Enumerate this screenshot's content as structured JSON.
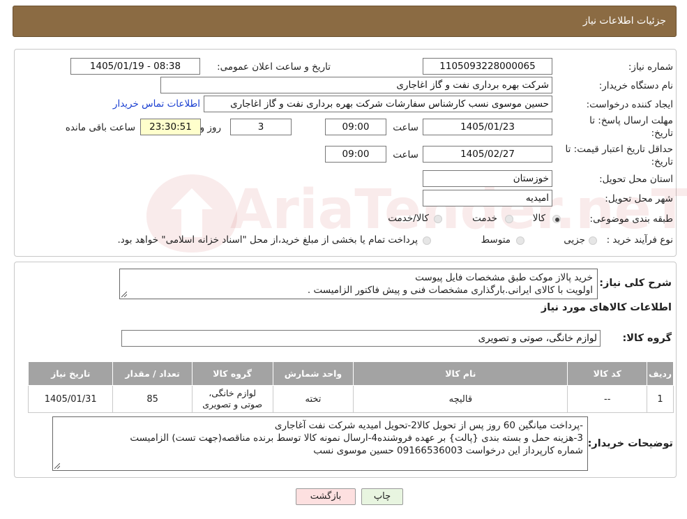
{
  "header": {
    "title": "جزئیات اطلاعات نیاز"
  },
  "watermark": "AriaTender.neT",
  "form": {
    "need_number_label": "شماره نیاز:",
    "need_number": "1105093228000065",
    "announce_label": "تاریخ و ساعت اعلان عمومی:",
    "announce_value": "1405/01/19 - 08:38",
    "buyer_org_label": "نام دستگاه خریدار:",
    "buyer_org": "شرکت بهره برداری نفت و گاز اغاجاری",
    "creator_label": "ایجاد کننده درخواست:",
    "creator": "حسین موسوی نسب کارشناس سفارشات شرکت بهره برداری نفت و گاز اغاجاری",
    "contact_link": "اطلاعات تماس خریدار",
    "deadline_label_1": "مهلت ارسال پاسخ: تا",
    "deadline_label_2": "تاریخ:",
    "deadline_date": "1405/01/23",
    "time_label": "ساعت",
    "deadline_time": "09:00",
    "days_value": "3",
    "days_label": "روز و",
    "remaining_time": "23:30:51",
    "remaining_label": "ساعت باقی مانده",
    "validity_label_1": "حداقل تاریخ اعتبار قیمت: تا",
    "validity_label_2": "تاریخ:",
    "validity_date": "1405/02/27",
    "validity_time": "09:00",
    "province_label": "استان محل تحویل:",
    "province": "خوزستان",
    "city_label": "شهر محل تحویل:",
    "city": "امیدیه",
    "category_label": "طبقه بندی موضوعی:",
    "category_options": [
      "کالا",
      "خدمت",
      "کالا/خدمت"
    ],
    "category_selected": "کالا",
    "process_label": "نوع فرآیند خرید :",
    "process_options": [
      "جزیی",
      "متوسط"
    ],
    "process_note": "پرداخت تمام یا بخشی از مبلغ خرید،از محل \"اسناد خزانه اسلامی\" خواهد بود."
  },
  "description": {
    "label": "شرح کلی نیاز:",
    "line1": "خرید  پالاز موکت   طبق  مشخصات فایل پیوست",
    "line2": "اولویت با کالای ایرانی.بارگذاری مشخصات فنی و پیش فاکتور الزامیست ."
  },
  "goods": {
    "section_title": "اطلاعات کالاهای مورد نیاز",
    "group_label": "گروه کالا:",
    "group_value": "لوازم خانگی، صوتی و تصویری",
    "columns": [
      "ردیف",
      "کد کالا",
      "نام کالا",
      "واحد شمارش",
      "گروه کالا",
      "تعداد / مقدار",
      "تاریخ نیاز"
    ],
    "rows": [
      {
        "row": "1",
        "code": "--",
        "name": "قالیچه",
        "unit": "تخته",
        "group": "لوازم خانگی، صوتی و تصویری",
        "qty": "85",
        "date": "1405/01/31"
      }
    ]
  },
  "buyer_notes": {
    "label": "توضیحات خریدار:",
    "line1": "-پرداخت میانگین 60 روز پس از تحویل کالا2-تحویل امیدیه شرکت نفت آغاجاری",
    "line2": "3-هزینه حمل  و بسته بندی {پالت} بر عهده فروشنده4-ارسال نمونه کالا توسط برنده مناقصه(جهت تست) الزامیست",
    "line3": "شماره کارپرداز این درخواست 09166536003 حسین موسوی نسب"
  },
  "buttons": {
    "print": "چاپ",
    "back": "بازگشت"
  },
  "colors": {
    "header_bg": "#8b6b43",
    "link": "#1a3fd1",
    "table_header": "#a3a3a3",
    "highlight": "#ffffcc",
    "back_button": "#fde0e0"
  }
}
